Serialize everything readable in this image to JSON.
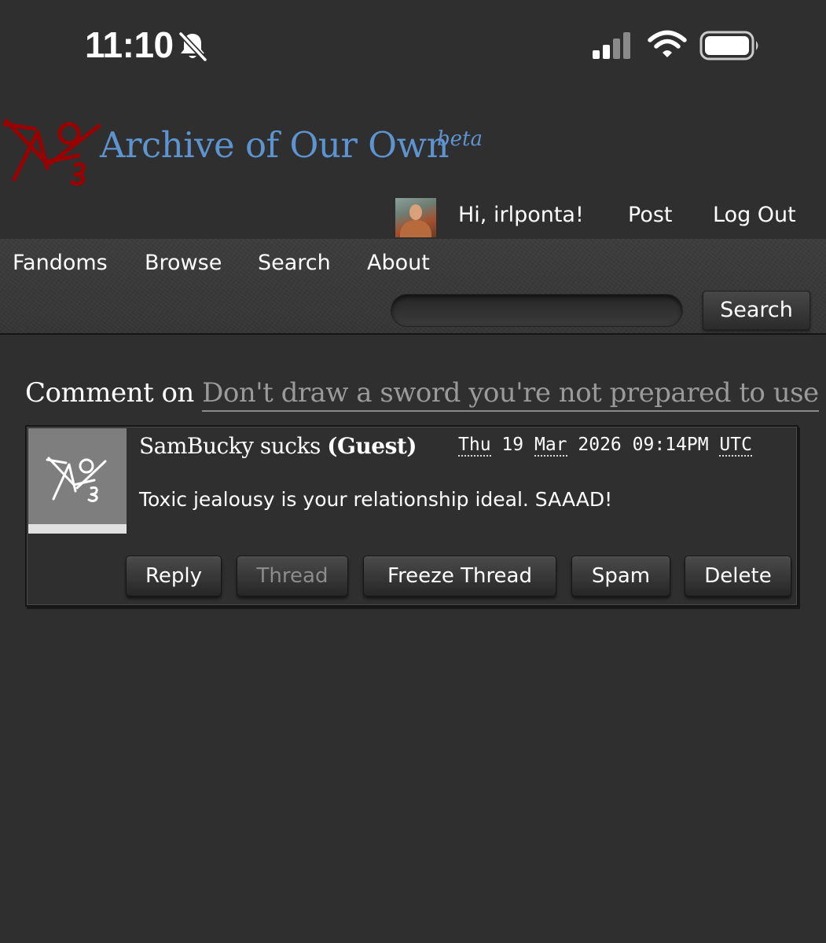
{
  "status_bar": {
    "time": "11:10",
    "icons": [
      "bell-slash-icon",
      "signal-bars-icon",
      "wifi-icon",
      "battery-icon"
    ]
  },
  "header": {
    "logo": "ao3-logo",
    "site_title": "Archive of Our Own",
    "beta_label": "beta",
    "title_color": "#5d93cf",
    "logo_color": "#990000"
  },
  "user_nav": {
    "greeting": "Hi, irlponta!",
    "post": "Post",
    "logout": "Log Out"
  },
  "primary_nav": {
    "items": [
      "Fandoms",
      "Browse",
      "Search",
      "About"
    ],
    "search_placeholder": "",
    "search_button": "Search"
  },
  "comment_page": {
    "heading_prefix": "Comment on",
    "work_title": "Don't draw a sword you're not prepared to use"
  },
  "comment": {
    "author": "SamBucky sucks",
    "guest_label": "(Guest)",
    "date": {
      "day": "Thu",
      "date_num": "19",
      "month": "Mar",
      "year": "2026",
      "time": "09:14PM",
      "timezone": "UTC"
    },
    "text": "Toxic jealousy is your relationship ideal. SAAAD!",
    "actions": {
      "reply": "Reply",
      "thread": "Thread",
      "freeze_thread": "Freeze Thread",
      "spam": "Spam",
      "delete": "Delete"
    }
  }
}
